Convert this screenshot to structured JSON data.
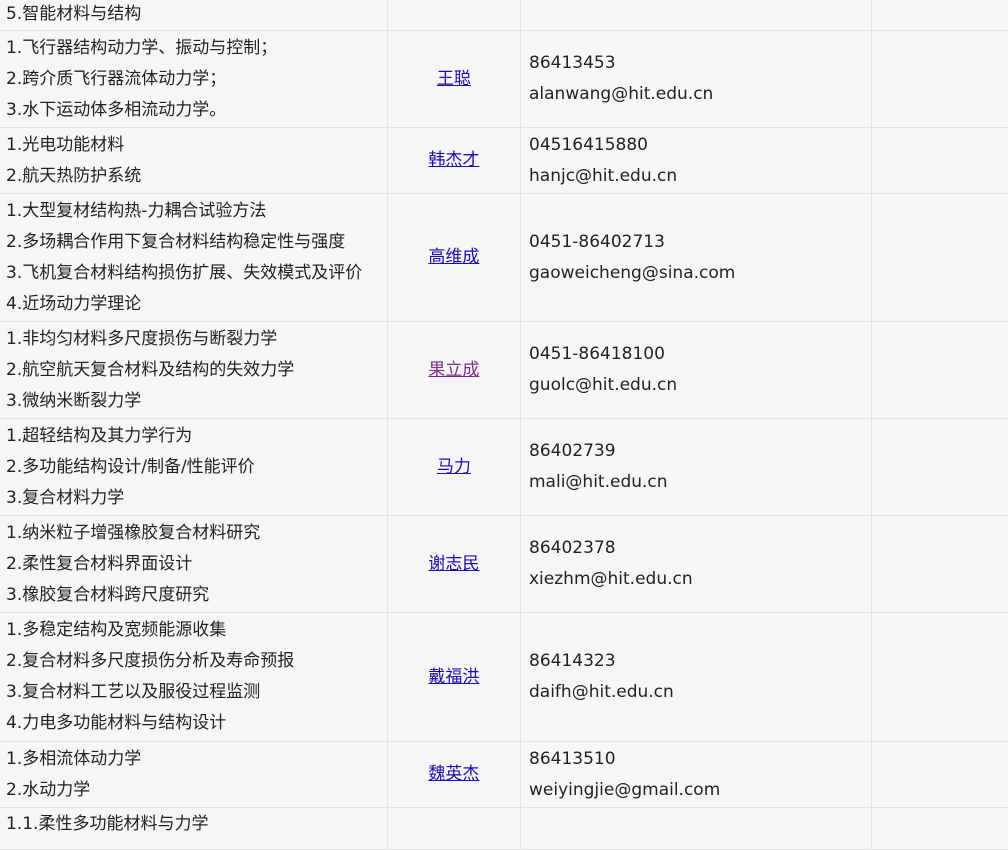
{
  "colors": {
    "cell_background": "#f6f6f6",
    "border": "#e2e2e2",
    "link": "#1a0dab",
    "link_visited": "#7d2c88",
    "text": "#222222"
  },
  "top_row": {
    "research": [
      "5.智能材料与结构"
    ]
  },
  "rows": [
    {
      "research": [
        "1.飞行器结构动力学、振动与控制；",
        "2.跨介质飞行器流体动力学；",
        "3.水下运动体多相流动力学。"
      ],
      "name": "王聪",
      "phone": "86413453",
      "email": "alanwang@hit.edu.cn"
    },
    {
      "research": [
        "1.光电功能材料",
        "2.航天热防护系统"
      ],
      "name": "韩杰才",
      "phone": "04516415880",
      "email": "hanjc@hit.edu.cn"
    },
    {
      "research": [
        "1.大型复材结构热-力耦合试验方法",
        "2.多场耦合作用下复合材料结构稳定性与强度",
        "3.飞机复合材料结构损伤扩展、失效模式及评价",
        "4.近场动力学理论"
      ],
      "name": "高维成",
      "phone": "0451-86402713",
      "email": "gaoweicheng@sina.com"
    },
    {
      "research": [
        "1.非均匀材料多尺度损伤与断裂力学",
        "2.航空航天复合材料及结构的失效力学",
        "3.微纳米断裂力学"
      ],
      "name": "果立成",
      "phone": "0451-86418100",
      "email": "guolc@hit.edu.cn"
    },
    {
      "research": [
        "1.超轻结构及其力学行为",
        "2.多功能结构设计/制备/性能评价",
        "3.复合材料力学"
      ],
      "name": "马力",
      "phone": "86402739",
      "email": "mali@hit.edu.cn"
    },
    {
      "research": [
        "1.纳米粒子增强橡胶复合材料研究",
        "2.柔性复合材料界面设计",
        "3.橡胶复合材料跨尺度研究"
      ],
      "name": "谢志民",
      "phone": "86402378",
      "email": "xiezhm@hit.edu.cn"
    },
    {
      "research": [
        "1.多稳定结构及宽频能源收集",
        "2.复合材料多尺度损伤分析及寿命预报",
        "3.复合材料工艺以及服役过程监测",
        "4.力电多功能材料与结构设计"
      ],
      "name": "戴福洪",
      "phone": "86414323",
      "email": "daifh@hit.edu.cn"
    },
    {
      "research": [
        "1.多相流体动力学",
        "2.水动力学"
      ],
      "name": "魏英杰",
      "phone": "86413510",
      "email": "weiyingjie@gmail.com"
    }
  ],
  "bottom_row": {
    "research": [
      "1.1.柔性多功能材料与力学"
    ]
  }
}
